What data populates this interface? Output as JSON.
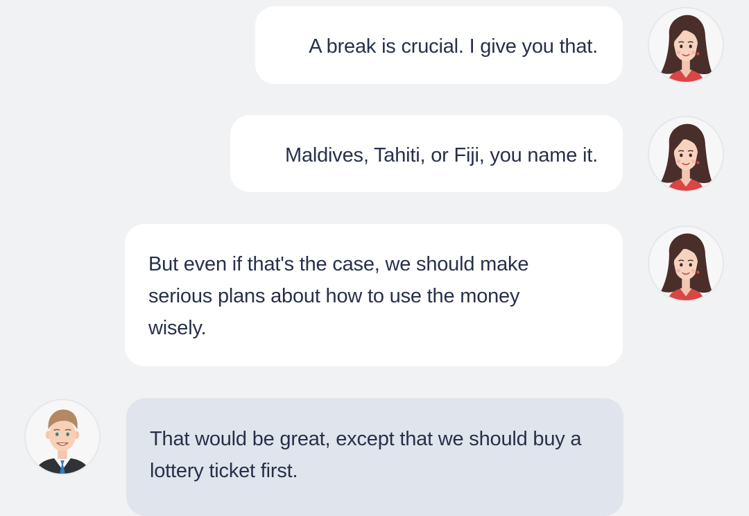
{
  "messages": [
    {
      "sender": "woman",
      "direction": "outgoing",
      "text": "A break is crucial. I give you that.",
      "avatar_icon": "woman-avatar-icon"
    },
    {
      "sender": "woman",
      "direction": "outgoing",
      "text": "Maldives, Tahiti, or Fiji, you name it.",
      "avatar_icon": "woman-avatar-icon"
    },
    {
      "sender": "woman",
      "direction": "outgoing",
      "text": "But even if that's the case, we should make serious plans about how to use the money wisely.",
      "avatar_icon": "woman-avatar-icon"
    },
    {
      "sender": "man",
      "direction": "incoming",
      "text": "That would be great, except that we should buy a lottery ticket first.",
      "avatar_icon": "man-avatar-icon"
    }
  ],
  "colors": {
    "background": "#f1f2f4",
    "outgoing_bubble": "#ffffff",
    "incoming_bubble": "#e0e4ec",
    "text": "#27304a"
  }
}
